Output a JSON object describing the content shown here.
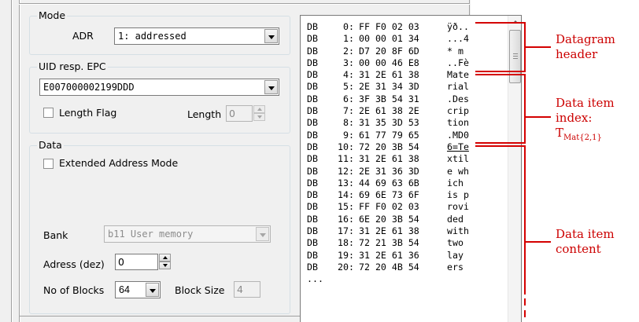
{
  "mode_group": {
    "legend": "Mode",
    "adr_label": "ADR",
    "adr_value": "1: addressed"
  },
  "uid_group": {
    "legend": "UID resp. EPC",
    "uid_value": "E007000002199DDD",
    "length_flag_label": "Length Flag",
    "length_flag_checked": false,
    "length_label": "Length",
    "length_value": "0"
  },
  "data_group": {
    "legend": "Data",
    "extended_address_label": "Extended Address Mode",
    "extended_address_checked": false,
    "bank_label": "Bank",
    "bank_value": "b11 User memory",
    "address_label": "Adress (dez)",
    "address_value": "0",
    "blocks_label": "No of Blocks",
    "blocks_value": "64",
    "block_size_label": "Block Size",
    "block_size_value": "4"
  },
  "datablocks": {
    "rows": [
      {
        "db": "DB",
        "idx": "0:",
        "hex": "FF F0 02 03",
        "ascii": "ÿð.."
      },
      {
        "db": "DB",
        "idx": "1:",
        "hex": "00 00 01 34",
        "ascii": "...4"
      },
      {
        "db": "DB",
        "idx": "2:",
        "hex": "D7 20 8F 6D",
        "ascii": "* m"
      },
      {
        "db": "DB",
        "idx": "3:",
        "hex": "00 00 46 E8",
        "ascii": "..Fè"
      },
      {
        "db": "DB",
        "idx": "4:",
        "hex": "31 2E 61 38",
        "ascii": "Mate"
      },
      {
        "db": "DB",
        "idx": "5:",
        "hex": "2E 31 34 3D",
        "ascii": "rial"
      },
      {
        "db": "DB",
        "idx": "6:",
        "hex": "3F 3B 54 31",
        "ascii": ".Des"
      },
      {
        "db": "DB",
        "idx": "7:",
        "hex": "2E 61 38 2E",
        "ascii": "crip"
      },
      {
        "db": "DB",
        "idx": "8:",
        "hex": "31 35 3D 53",
        "ascii": "tion"
      },
      {
        "db": "DB",
        "idx": "9:",
        "hex": "61 77 79 65",
        "ascii": ".MD0"
      },
      {
        "db": "DB",
        "idx": "10:",
        "hex": "72 20 3B 54",
        "ascii": "6=Te"
      },
      {
        "db": "DB",
        "idx": "11:",
        "hex": "31 2E 61 38",
        "ascii": "xtil"
      },
      {
        "db": "DB",
        "idx": "12:",
        "hex": "2E 31 36 3D",
        "ascii": "e wh"
      },
      {
        "db": "DB",
        "idx": "13:",
        "hex": "44 69 63 6B",
        "ascii": "ich"
      },
      {
        "db": "DB",
        "idx": "14:",
        "hex": "69 6E 73 6F",
        "ascii": "is p"
      },
      {
        "db": "DB",
        "idx": "15:",
        "hex": "FF F0 02 03",
        "ascii": "rovi"
      },
      {
        "db": "DB",
        "idx": "16:",
        "hex": "6E 20 3B 54",
        "ascii": "ded"
      },
      {
        "db": "DB",
        "idx": "17:",
        "hex": "31 2E 61 38",
        "ascii": "with"
      },
      {
        "db": "DB",
        "idx": "18:",
        "hex": "72 21 3B 54",
        "ascii": "two"
      },
      {
        "db": "DB",
        "idx": "19:",
        "hex": "31 2E 61 36",
        "ascii": "lay"
      },
      {
        "db": "DB",
        "idx": "20:",
        "hex": "72 20 4B 54",
        "ascii": "ers"
      }
    ],
    "more": "..."
  },
  "annotations": {
    "header_line1": "Datagram",
    "header_line2": "header",
    "index_line1": "Data item",
    "index_line2": "index:",
    "index_symbol": "T",
    "index_subscript": "Mat{2,1}",
    "content_line1": "Data item",
    "content_line2": "content",
    "color": "#cc0000"
  }
}
